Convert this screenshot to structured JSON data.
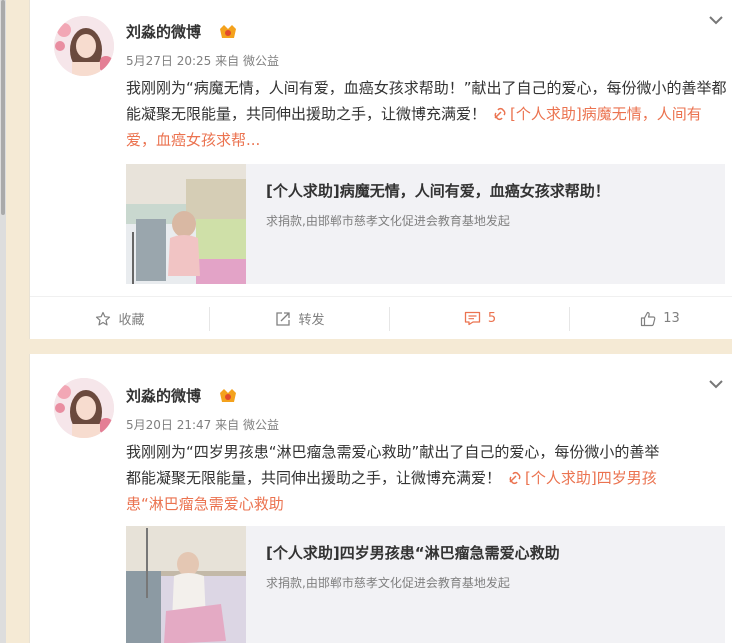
{
  "posts": [
    {
      "username": "刘淼的微博",
      "date": "5月27日 20:25",
      "source_prefix": "来自",
      "source": "微公益",
      "text": "我刚刚为“病魔无情，人间有爱，血癌女孩求帮助！”献出了自己的爱心，每份微小的善举都能凝聚无限能量，共同伸出援助之手，让微博充满爱！",
      "link_line1": "[个人求助]病",
      "link_line2": "魔无情，人间有爱，血癌女孩求帮...",
      "share_title": "[个人求助]病魔无情，人间有爱，血癌女孩求帮助！",
      "share_desc": "求捐款,由邯郸市慈孝文化促进会教育基地发起",
      "actions": {
        "favorite": "收藏",
        "repost": "转发",
        "comment": "5",
        "like": "13"
      }
    },
    {
      "username": "刘淼的微博",
      "date": "5月20日 21:47",
      "source_prefix": "来自",
      "source": "微公益",
      "text_line1": "我刚刚为“四岁男孩患“淋巴瘤急需爱心救助”献出了自己的爱心，每份微小的善举",
      "text_line2": "都能凝聚无限能量，共同伸出援助之手，让微博充满爱！",
      "link_line1": "[个人求助]四岁男孩",
      "link_line2": "患“淋巴瘤急需爱心救助",
      "share_title": "[个人求助]四岁男孩患“淋巴瘤急需爱心救助",
      "share_desc": "求捐款,由邯郸市慈孝文化促进会教育基地发起"
    }
  ],
  "icons": {
    "chevron": "chevron-down-icon",
    "vip": "vip-badge-icon",
    "link": "link-icon",
    "favorite": "star-icon",
    "repost": "repost-icon",
    "comment": "comment-icon",
    "like": "thumbs-up-icon"
  },
  "colors": {
    "accent": "#eb7350",
    "background": "#f5ead5",
    "card": "#ffffff",
    "muted": "#808080"
  }
}
